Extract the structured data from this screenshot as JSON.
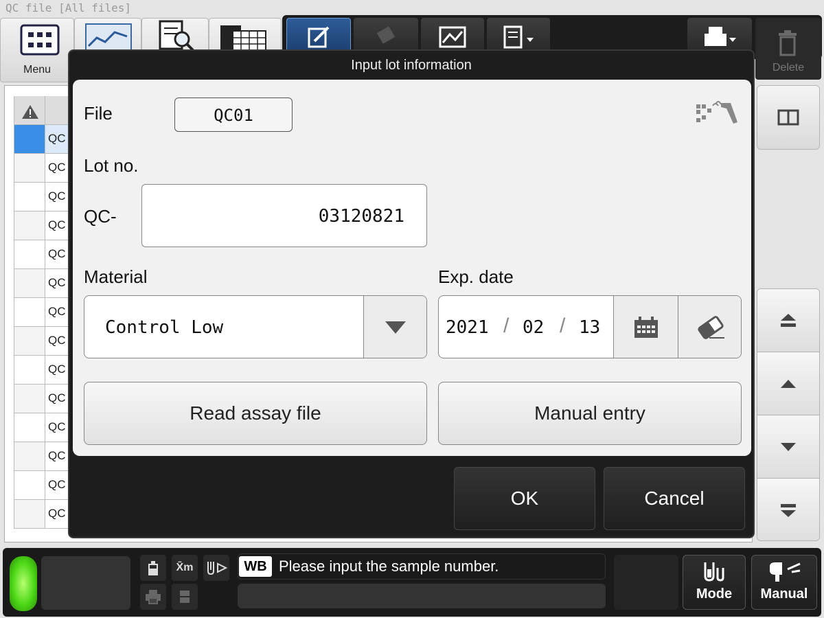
{
  "window": {
    "title": "QC file [All files]"
  },
  "toolbar": {
    "menu_label": "Menu",
    "delete_label": "Delete"
  },
  "list": {
    "rows": [
      "QC",
      "QC",
      "QC",
      "QC",
      "QC",
      "QC",
      "QC",
      "QC",
      "QC",
      "QC",
      "QC",
      "QC",
      "QC",
      "QC"
    ]
  },
  "dialog": {
    "title": "Input lot information",
    "file_label": "File",
    "file_value": "QC01",
    "lot_label": "Lot no.",
    "lot_prefix": "QC-",
    "lot_value": "03120821",
    "material_label": "Material",
    "material_value": "Control Low",
    "exp_label": "Exp. date",
    "exp_year": "2021",
    "exp_month": "02",
    "exp_day": "13",
    "read_assay_label": "Read assay file",
    "manual_entry_label": "Manual entry",
    "ok_label": "OK",
    "cancel_label": "Cancel"
  },
  "status": {
    "xm_label": "X̄m",
    "wb_badge": "WB",
    "message": "Please input the sample number.",
    "mode_label": "Mode",
    "manual_label": "Manual"
  },
  "colors": {
    "led": "#4cd816",
    "selected_row": "#3a8ee6",
    "active_tool": "#2e5c99"
  }
}
